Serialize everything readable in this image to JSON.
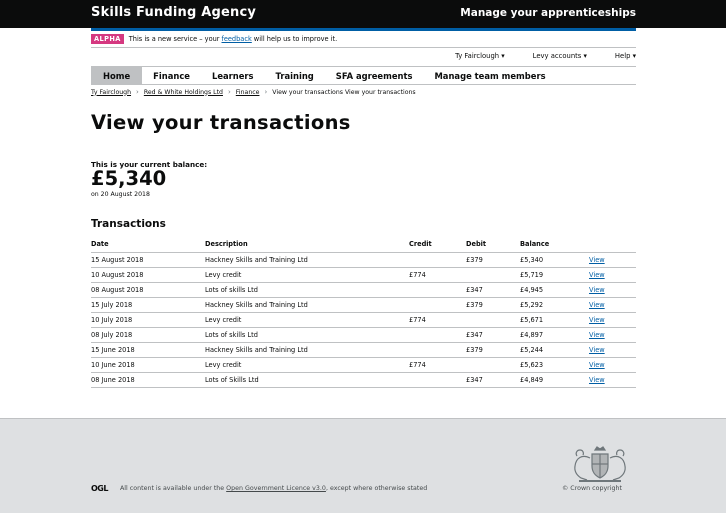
{
  "header": {
    "brand": "Skills Funding Agency",
    "service": "Manage your apprenticeships"
  },
  "phase_banner": {
    "tag": "ALPHA",
    "text_before": "This is a new service – your",
    "link": "feedback",
    "text_after": "will help us to improve it."
  },
  "account_nav": {
    "user": "Ty Fairclough ▾",
    "levy": "Levy accounts ▾",
    "help": "Help ▾"
  },
  "main_nav": {
    "items": [
      "Home",
      "Finance",
      "Learners",
      "Training",
      "SFA agreements",
      "Manage team members"
    ]
  },
  "breadcrumb": {
    "items": [
      "Ty Fairclough",
      "Red & White Holdings Ltd",
      "Finance"
    ],
    "current": "View your transactions View your transactions"
  },
  "page": {
    "title": "View your transactions",
    "balance_label": "This is your current balance:",
    "balance": "£5,340",
    "balance_date": "on 20 August 2018",
    "transactions_heading": "Transactions"
  },
  "table": {
    "headers": [
      "Date",
      "Description",
      "Credit",
      "Debit",
      "Balance",
      ""
    ],
    "rows": [
      {
        "date": "15 August 2018",
        "description": "Hackney Skills and Training Ltd",
        "credit": "",
        "debit": "£379",
        "balance": "£5,340",
        "action": "View"
      },
      {
        "date": "10 August 2018",
        "description": "Levy credit",
        "credit": "£774",
        "debit": "",
        "balance": "£5,719",
        "action": "View"
      },
      {
        "date": "08 August 2018",
        "description": "Lots of skills Ltd",
        "credit": "",
        "debit": "£347",
        "balance": "£4,945",
        "action": "View"
      },
      {
        "date": "15 July 2018",
        "description": "Hackney Skills and Training Ltd",
        "credit": "",
        "debit": "£379",
        "balance": "£5,292",
        "action": "View"
      },
      {
        "date": "10 July 2018",
        "description": "Levy credit",
        "credit": "£774",
        "debit": "",
        "balance": "£5,671",
        "action": "View"
      },
      {
        "date": "08 July 2018",
        "description": "Lots of skills Ltd",
        "credit": "",
        "debit": "£347",
        "balance": "£4,897",
        "action": "View"
      },
      {
        "date": "15 June 2018",
        "description": "Hackney Skills and Training Ltd",
        "credit": "",
        "debit": "£379",
        "balance": "£5,244",
        "action": "View"
      },
      {
        "date": "10 June 2018",
        "description": "Levy credit",
        "credit": "£774",
        "debit": "",
        "balance": "£5,623",
        "action": "View"
      },
      {
        "date": "08 June 2018",
        "description": "Lots of Skills Ltd",
        "credit": "",
        "debit": "£347",
        "balance": "£4,849",
        "action": "View"
      }
    ]
  },
  "footer": {
    "ogl": "OGL",
    "licence_before": "All content is available under the",
    "licence_link": "Open Government Licence v3.0",
    "licence_after": ", except where otherwise stated",
    "copyright": "© Crown copyright"
  },
  "colors": {
    "header_bg": "#0b0c0c",
    "accent_blue": "#005ea5",
    "alpha_tag": "#d53880",
    "footer_bg": "#dee0e2"
  }
}
